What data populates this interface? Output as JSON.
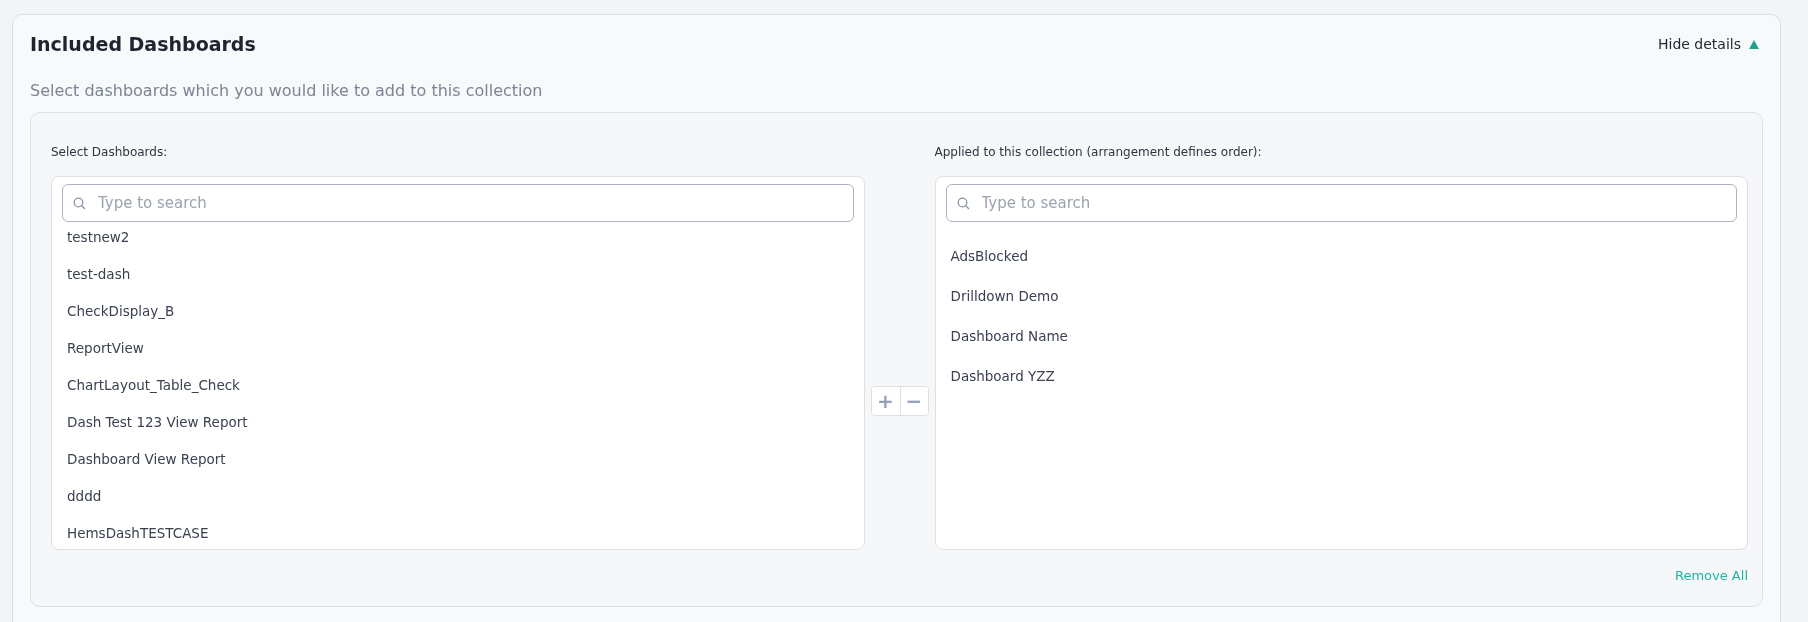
{
  "section": {
    "title": "Included Dashboards",
    "toggle": {
      "label": "Hide details",
      "expanded": true
    },
    "subtitle": "Select dashboards which you would like to add to this collection"
  },
  "available": {
    "label": "Select Dashboards:",
    "search": {
      "placeholder": "Type to search"
    },
    "items": [
      "testnew2",
      "test-dash",
      "CheckDisplay_B",
      "ReportView",
      "ChartLayout_Table_Check",
      "Dash Test 123 View Report",
      "Dashboard View Report",
      "dddd",
      "HemsDashTESTCASE"
    ]
  },
  "transfer_buttons": [
    "+",
    "−"
  ],
  "applied": {
    "label": "Applied to this collection (arrangement defines order):",
    "search": {
      "placeholder": "Type to search"
    },
    "items": [
      "AdsBlocked",
      "Drilldown Demo",
      "Dashboard Name",
      "Dashboard YZZ"
    ],
    "remove_all": "Remove All"
  }
}
